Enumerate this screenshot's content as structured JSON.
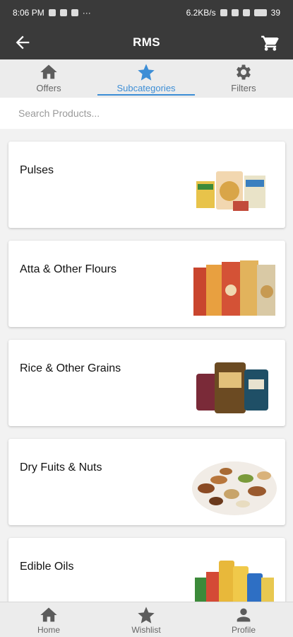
{
  "status_bar": {
    "time": "8:06 PM",
    "dots": "···",
    "net_speed": "6.2KB/s",
    "battery": "39"
  },
  "app_bar": {
    "title": "RMS"
  },
  "tabs": [
    {
      "label": "Offers",
      "icon": "home-icon"
    },
    {
      "label": "Subcategories",
      "icon": "star-icon",
      "active": true
    },
    {
      "label": "Filters",
      "icon": "gear-icon"
    }
  ],
  "search": {
    "placeholder": "Search Products..."
  },
  "categories": [
    {
      "name": "Pulses",
      "image": "pulses-packets"
    },
    {
      "name": "Atta & Other Flours",
      "image": "flour-bags"
    },
    {
      "name": "Rice & Other Grains",
      "image": "rice-bags"
    },
    {
      "name": "Dry Fuits & Nuts",
      "image": "dry-fruits-mix"
    },
    {
      "name": "Edible Oils",
      "image": "oil-bottles"
    }
  ],
  "bottom_nav": [
    {
      "label": "Home",
      "icon": "home-icon"
    },
    {
      "label": "Wishlist",
      "icon": "star-icon"
    },
    {
      "label": "Profile",
      "icon": "person-icon"
    }
  ],
  "colors": {
    "accent": "#3d8ed6",
    "appbar": "#3a3a3a",
    "tabbar": "#ececec"
  }
}
